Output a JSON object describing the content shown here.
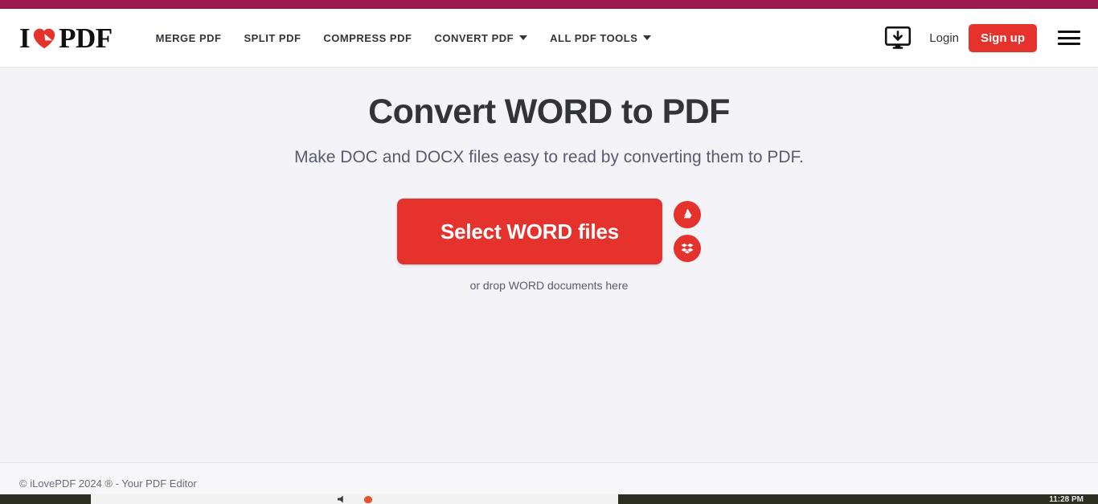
{
  "browser": {
    "top_strip_color": "#9e1950"
  },
  "header": {
    "logo": {
      "text_left": "I",
      "text_right": "PDF",
      "heart_icon": "heart-page-icon",
      "heart_color": "#e5322d"
    },
    "nav": [
      {
        "label": "MERGE PDF",
        "has_caret": false
      },
      {
        "label": "SPLIT PDF",
        "has_caret": false
      },
      {
        "label": "COMPRESS PDF",
        "has_caret": false
      },
      {
        "label": "CONVERT PDF",
        "has_caret": true
      },
      {
        "label": "ALL PDF TOOLS",
        "has_caret": true
      }
    ],
    "desktop_icon": "desktop-download-icon",
    "login_label": "Login",
    "signup_label": "Sign up",
    "signup_color": "#e5322d",
    "menu_icon": "hamburger-menu-icon"
  },
  "main": {
    "title": "Convert WORD to PDF",
    "subtitle": "Make DOC and DOCX files easy to read by converting them to PDF.",
    "select_button_label": "Select WORD files",
    "drop_hint": "or drop WORD documents here",
    "cloud_buttons": [
      {
        "name": "google-drive-icon",
        "label": "Google Drive"
      },
      {
        "name": "dropbox-icon",
        "label": "Dropbox"
      }
    ],
    "accent_color": "#e5322d",
    "title_color": "#33333a",
    "background_color": "#f4f4f8"
  },
  "footer": {
    "text": "© iLovePDF 2024 ® - Your PDF Editor"
  },
  "taskbar": {
    "clock": "11:28 PM",
    "background_color": "#2d3021"
  }
}
